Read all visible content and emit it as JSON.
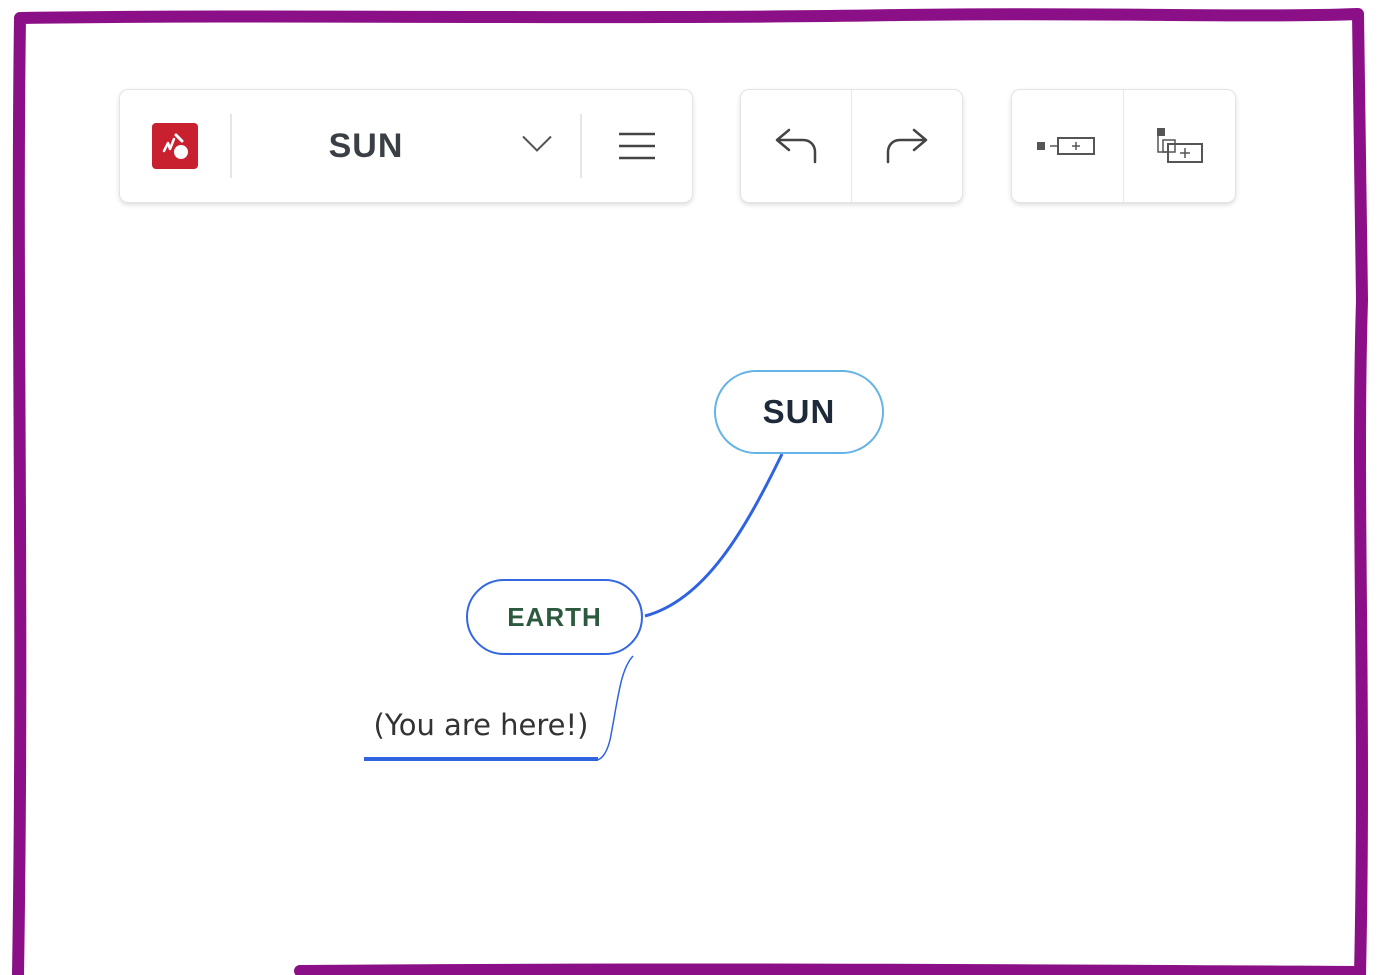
{
  "toolbar": {
    "logo_icon": "mindmeister-logo-icon",
    "map_title": "SUN",
    "dropdown_icon": "chevron-down-icon",
    "menu_icon": "hamburger-menu-icon",
    "undo_icon": "undo-icon",
    "redo_icon": "redo-icon",
    "add_sibling_icon": "add-sibling-topic-icon",
    "add_child_icon": "add-child-topic-icon"
  },
  "map": {
    "root_topic": "SUN",
    "child_topic": "EARTH",
    "note": "(You are here!)"
  },
  "colors": {
    "frame": "#8b0f86",
    "root_border": "#66b3e6",
    "child_border": "#3468e0",
    "connector": "#2f63e0",
    "logo": "#c8202f",
    "child_text": "#2d5a3f"
  }
}
